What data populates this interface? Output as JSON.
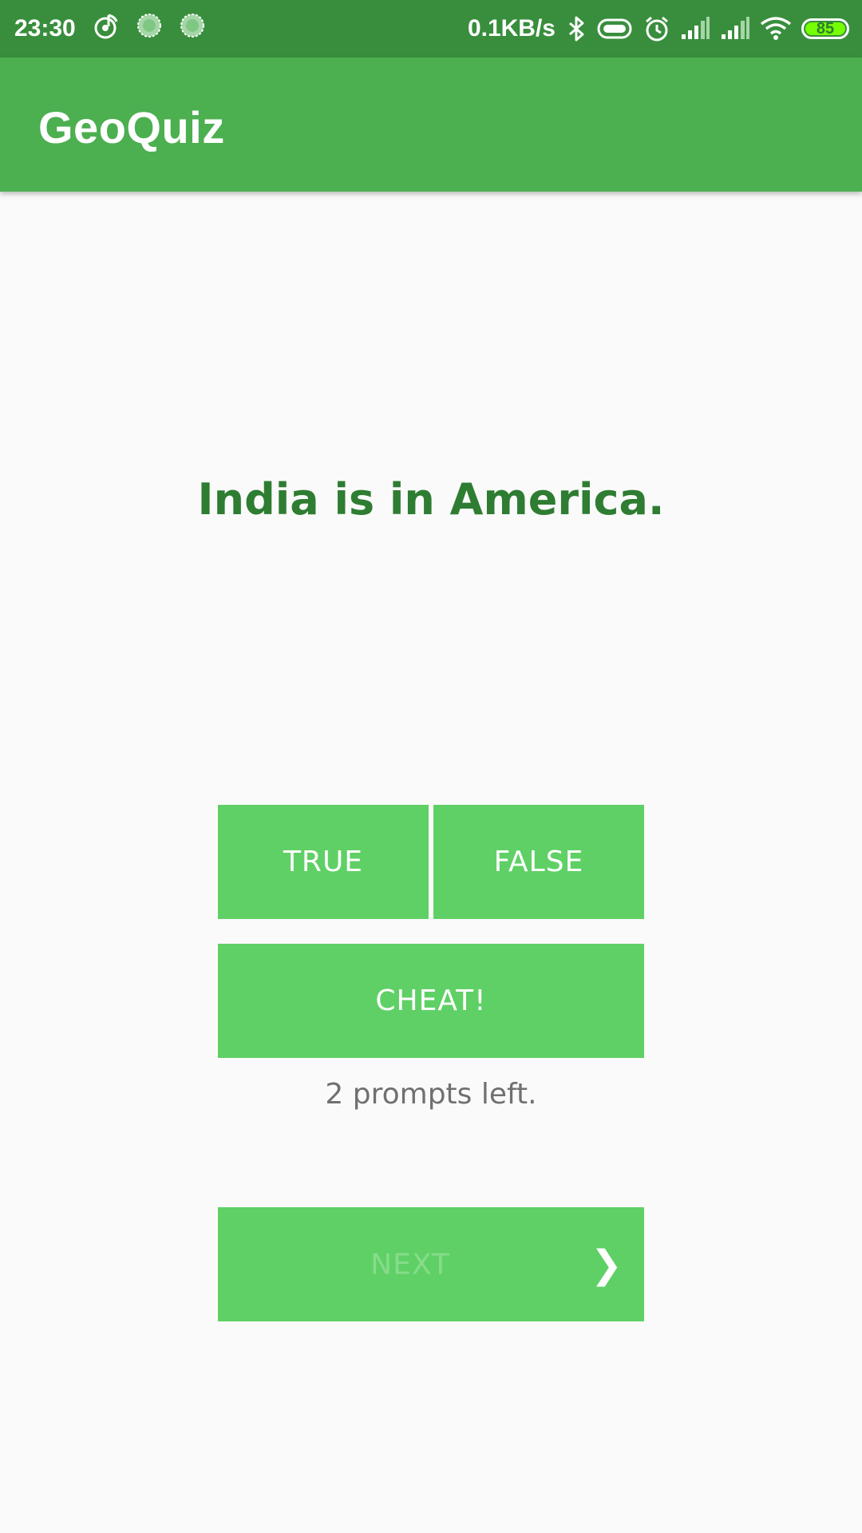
{
  "status_bar": {
    "time": "23:30",
    "net_speed": "0.1KB/s",
    "battery_level": "85",
    "icons": [
      "music-note-icon",
      "spinner-icon",
      "spinner-icon",
      "bluetooth-icon",
      "vibrate-icon",
      "alarm-icon",
      "signal-icon",
      "signal-icon",
      "wifi-icon",
      "battery-icon"
    ]
  },
  "app_bar": {
    "title": "GeoQuiz"
  },
  "quiz": {
    "question": "India is in America.",
    "true_label": "TRUE",
    "false_label": "FALSE",
    "cheat_label": "CHEAT!",
    "prompts_left": "2 prompts left.",
    "next_label": "NEXT",
    "next_arrow": "❯"
  },
  "colors": {
    "status_bar": "#388e3c",
    "app_bar": "#4caf50",
    "button": "#5fd065",
    "question_text": "#2e7d32",
    "background": "#fafafa"
  }
}
